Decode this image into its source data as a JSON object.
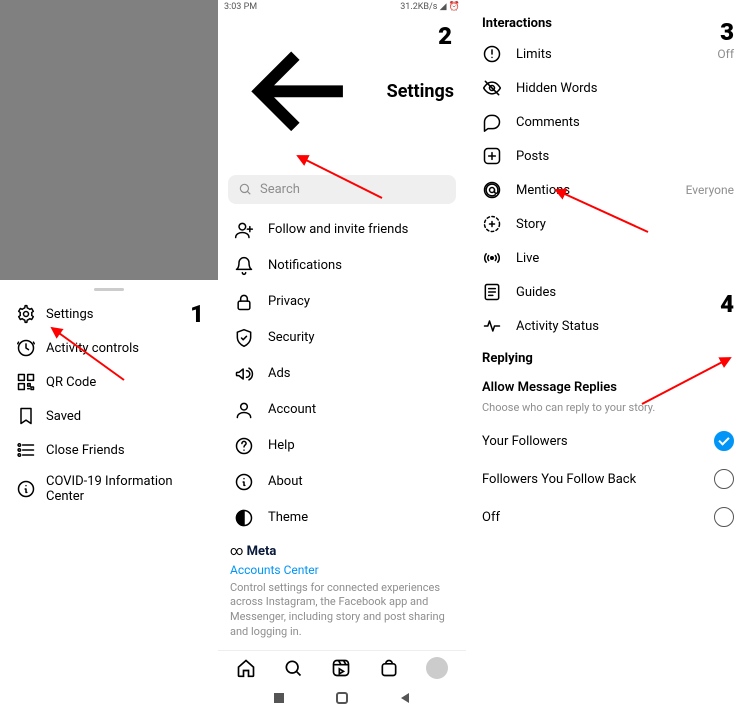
{
  "panel1": {
    "items": [
      {
        "label": "Settings",
        "icon": "gear-icon"
      },
      {
        "label": "Activity controls",
        "icon": "clock-icon"
      },
      {
        "label": "QR Code",
        "icon": "qr-icon"
      },
      {
        "label": "Saved",
        "icon": "bookmark-icon"
      },
      {
        "label": "Close Friends",
        "icon": "list-icon"
      },
      {
        "label": "COVID-19 Information Center",
        "icon": "info-icon"
      }
    ],
    "step": "1"
  },
  "panel2": {
    "status": {
      "time": "3:03 PM",
      "net": "31.2KB/s"
    },
    "title": "Settings",
    "search_placeholder": "Search",
    "items": [
      {
        "label": "Follow and invite friends",
        "icon": "add-user-icon"
      },
      {
        "label": "Notifications",
        "icon": "bell-icon"
      },
      {
        "label": "Privacy",
        "icon": "lock-icon"
      },
      {
        "label": "Security",
        "icon": "shield-icon"
      },
      {
        "label": "Ads",
        "icon": "megaphone-icon"
      },
      {
        "label": "Account",
        "icon": "user-icon"
      },
      {
        "label": "Help",
        "icon": "help-icon"
      },
      {
        "label": "About",
        "icon": "info-icon"
      },
      {
        "label": "Theme",
        "icon": "theme-icon"
      }
    ],
    "meta_brand": "Meta",
    "accounts_center": "Accounts Center",
    "meta_desc": "Control settings for connected experiences across Instagram, the Facebook app and Messenger, including story and post sharing and logging in.",
    "step": "2"
  },
  "panel3": {
    "section": "Interactions",
    "items": [
      {
        "label": "Limits",
        "icon": "limits-icon",
        "value": "Off"
      },
      {
        "label": "Hidden Words",
        "icon": "eye-icon",
        "value": ""
      },
      {
        "label": "Comments",
        "icon": "comment-icon",
        "value": ""
      },
      {
        "label": "Posts",
        "icon": "plus-icon",
        "value": ""
      },
      {
        "label": "Mentions",
        "icon": "mention-icon",
        "value": "Everyone"
      },
      {
        "label": "Story",
        "icon": "story-plus-icon",
        "value": ""
      },
      {
        "label": "Live",
        "icon": "live-icon",
        "value": ""
      },
      {
        "label": "Guides",
        "icon": "guides-icon",
        "value": ""
      },
      {
        "label": "Activity Status",
        "icon": "activity-icon",
        "value": ""
      }
    ],
    "step": "3",
    "replying_title": "Replying",
    "allow_title": "Allow Message Replies",
    "allow_sub": "Choose who can reply to your story.",
    "options": [
      {
        "label": "Your Followers",
        "checked": true
      },
      {
        "label": "Followers You Follow Back",
        "checked": false
      },
      {
        "label": "Off",
        "checked": false
      }
    ],
    "step2": "4"
  }
}
